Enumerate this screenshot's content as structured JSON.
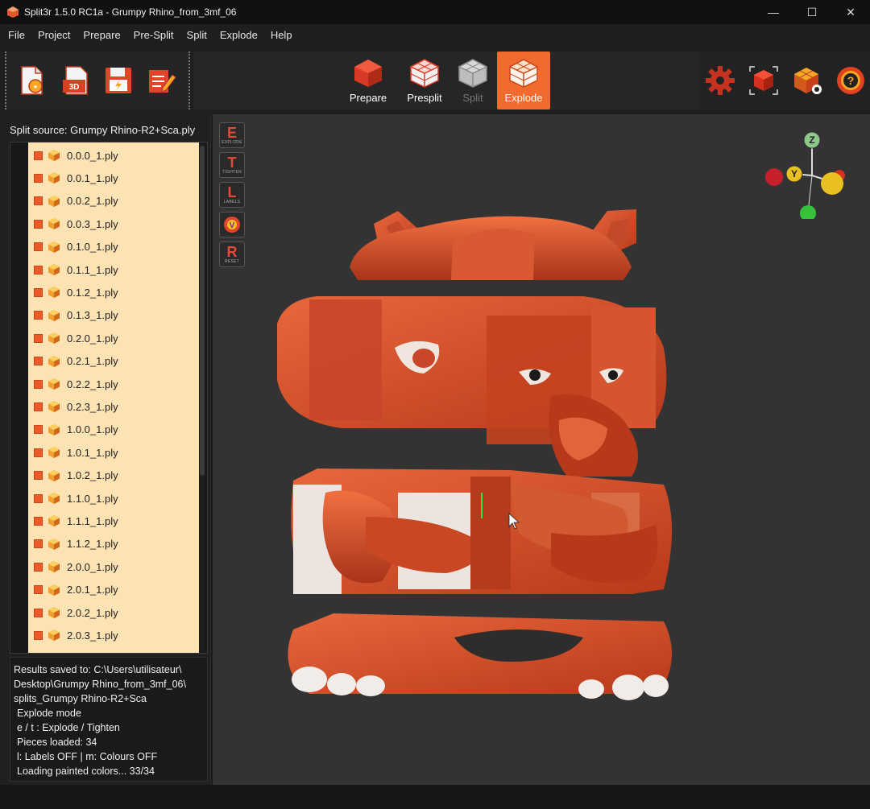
{
  "window": {
    "title": "Split3r 1.5.0 RC1a - Grumpy Rhino_from_3mf_06",
    "minimize": "—",
    "maximize": "☐",
    "close": "✕"
  },
  "menu": [
    "File",
    "Project",
    "Prepare",
    "Pre-Split",
    "Split",
    "Explode",
    "Help"
  ],
  "toolbar": {
    "file_icons": [
      "new-project-icon",
      "open-3d-icon",
      "save-icon",
      "edit-notes-icon"
    ],
    "modes": [
      {
        "label": "Prepare",
        "icon": "cube-icon",
        "state": "normal"
      },
      {
        "label": "Presplit",
        "icon": "grid-cube-icon",
        "state": "normal"
      },
      {
        "label": "Split",
        "icon": "split-cube-icon",
        "state": "disabled"
      },
      {
        "label": "Explode",
        "icon": "explode-cube-icon",
        "state": "active"
      }
    ],
    "right_icons": [
      "settings-gear-icon",
      "view-frame-icon",
      "cube-view-icon",
      "help-icon"
    ],
    "accent": "#f26a2e"
  },
  "left_panel": {
    "split_source": "Split source: Grumpy Rhino-R2+Sca.ply",
    "files": [
      "0.0.0_1.ply",
      "0.0.1_1.ply",
      "0.0.2_1.ply",
      "0.0.3_1.ply",
      "0.1.0_1.ply",
      "0.1.1_1.ply",
      "0.1.2_1.ply",
      "0.1.3_1.ply",
      "0.2.0_1.ply",
      "0.2.1_1.ply",
      "0.2.2_1.ply",
      "0.2.3_1.ply",
      "1.0.0_1.ply",
      "1.0.1_1.ply",
      "1.0.2_1.ply",
      "1.1.0_1.ply",
      "1.1.1_1.ply",
      "1.1.2_1.ply",
      "2.0.0_1.ply",
      "2.0.1_1.ply",
      "2.0.2_1.ply",
      "2.0.3_1.ply"
    ],
    "log": [
      "Results saved to: C:\\Users\\utilisateur\\",
      "Desktop\\Grumpy Rhino_from_3mf_06\\",
      "splits_Grumpy Rhino-R2+Sca",
      " Explode mode",
      " e / t : Explode / Tighten",
      " Pieces loaded: 34",
      " l: Labels OFF | m: Colours OFF",
      " Loading painted colors... 33/34"
    ]
  },
  "viewport": {
    "side_keys": [
      {
        "key": "E",
        "caption": "EXPLODE"
      },
      {
        "key": "T",
        "caption": "TIGHTEN"
      },
      {
        "key": "L",
        "caption": "LABELS"
      },
      {
        "key": "V",
        "caption": ""
      },
      {
        "key": "R",
        "caption": "RESET"
      }
    ],
    "gizmo": {
      "z": "Z",
      "y": "Y"
    },
    "model_color": "#d9512c"
  }
}
